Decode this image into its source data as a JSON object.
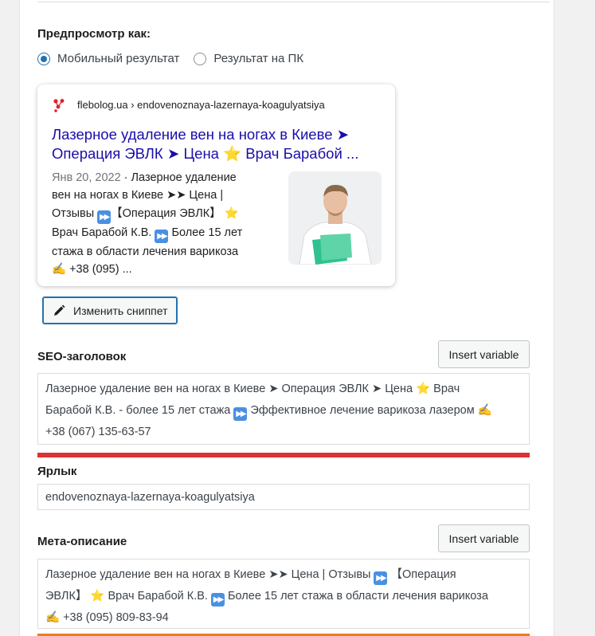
{
  "preview": {
    "label": "Предпросмотр как:",
    "options": [
      {
        "label": "Мобильный результат",
        "checked": true
      },
      {
        "label": "Результат на ПК",
        "checked": false
      }
    ]
  },
  "snippet": {
    "url": "flebolog.ua › endovenoznaya-lazernaya-koagulyatsiya",
    "title_line1": "Лазерное удаление вен на ногах в Киеве ➤",
    "title_line2": "Операция ЭВЛК ➤ Цена ⭐ Врач Барабой ...",
    "date": "Янв 20, 2022",
    "desc_line1": " · Лазерное удаление",
    "desc_line2": "вен на ногах в Киеве ➤➤ Цена |",
    "desc_line3a": "Отзывы ",
    "desc_line3b": "【Операция ЭВЛК】 ",
    "desc_line4a": "Врач Барабой К.В. ",
    "desc_line4b": " Более 15 лет",
    "desc_line5": "стажа в области лечения варикоза",
    "desc_line6": " +38 (095) ..."
  },
  "edit_button": {
    "label": "Изменить сниппет",
    "icon": "pencil-icon"
  },
  "seo_title": {
    "label": "SEO-заголовок",
    "insert_label": "Insert variable",
    "line1a": "Лазерное удаление вен на ногах в Киеве ➤ Операция ЭВЛК ➤ Цена ",
    "line1b": " Врач",
    "line2a": "Барабой К.В. - более 15 лет стажа ",
    "line2b": " Эффективное лечение варикоза лазером ",
    "line3": "+38 (067) 135-63-57",
    "progress_color": "#dc3232"
  },
  "slug": {
    "label": "Ярлык",
    "value": "endovenoznaya-lazernaya-koagulyatsiya"
  },
  "meta": {
    "label": "Мета-описание",
    "insert_label": "Insert variable",
    "line1a": "Лазерное удаление вен на ногах в Киеве ➤➤ Цена | Отзывы ",
    "line1b": " 【Операция",
    "line2a": "ЭВЛК】 ",
    "line2b": " Врач Барабой К.В. ",
    "line2c": " Более 15 лет стажа в области лечения варикоза",
    "line3": " +38 (095) 809-83-94",
    "progress_color": "#ee7c1b"
  },
  "colors": {
    "accent": "#2271b1",
    "link": "#1a0dab"
  }
}
